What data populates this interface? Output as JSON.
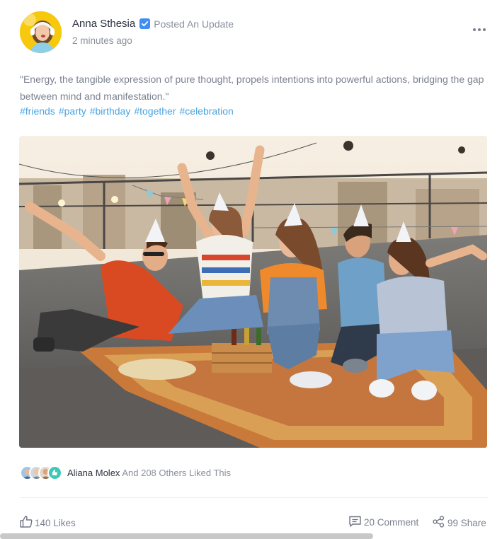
{
  "post": {
    "author": "Anna Sthesia",
    "action": "Posted An Update",
    "timestamp": "2 minutes ago",
    "verified": true,
    "more_icon": "more-dots-icon",
    "quote": "\"Energy, the tangible expression of pure thought, propels intentions into powerful actions, bridging the gap between mind and manifestation.\"",
    "hashtags": [
      "#friends",
      "#party",
      "#birthday",
      "#together",
      "#celebration"
    ]
  },
  "likers": {
    "name": "Aliana Molex",
    "rest": "And 208 Others Liked This"
  },
  "footer": {
    "likes_label": "140 Likes",
    "comment_label": "20 Comment",
    "share_label": "99 Share"
  },
  "colors": {
    "accent": "#4aa3e0",
    "verified": "#3f8ef2",
    "text_muted": "#7b8190",
    "avatar_bg": "#f6c90e"
  }
}
